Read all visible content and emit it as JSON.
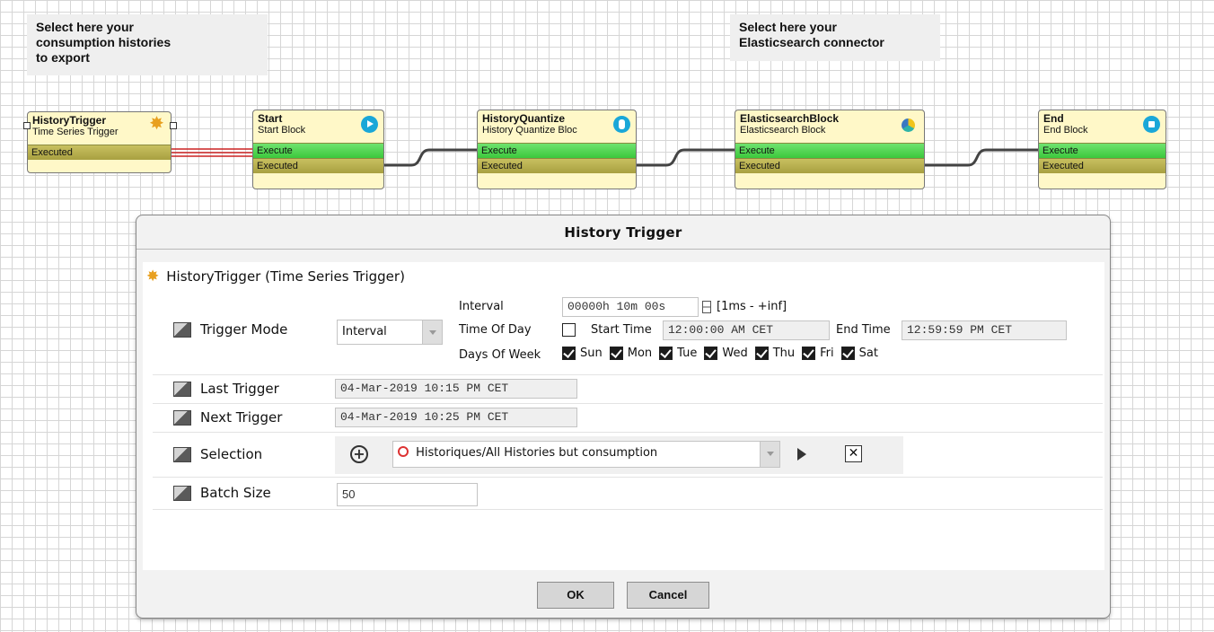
{
  "notes": {
    "left": [
      "Select here your",
      "consumption histories",
      "to export"
    ],
    "right": [
      "Select here your",
      "Elasticsearch connector"
    ]
  },
  "blocks": [
    {
      "title": "HistoryTrigger",
      "subtitle": "Time Series Trigger",
      "rows": [
        "Executed"
      ],
      "icon": "star-burst-icon"
    },
    {
      "title": "Start",
      "subtitle": "Start Block",
      "rows": [
        "Execute",
        "Executed"
      ],
      "icon": "play-icon"
    },
    {
      "title": "HistoryQuantize",
      "subtitle": "History Quantize Bloc",
      "rows": [
        "Execute",
        "Executed"
      ],
      "icon": "database-icon"
    },
    {
      "title": "ElasticsearchBlock",
      "subtitle": "Elasticsearch Block",
      "rows": [
        "Execute",
        "Executed"
      ],
      "icon": "elasticsearch-icon"
    },
    {
      "title": "End",
      "subtitle": "End Block",
      "rows": [
        "Execute",
        "Executed"
      ],
      "icon": "stop-icon"
    }
  ],
  "dialog": {
    "title": "History  Trigger",
    "component_header": "HistoryTrigger  (Time Series Trigger)",
    "trigger_mode": {
      "label": "Trigger Mode",
      "value": "Interval",
      "interval_label": "Interval",
      "interval_value": "00000h 10m 00s",
      "interval_range": "[1ms - +inf]",
      "time_of_day_label": "Time Of Day",
      "start_time_label": "Start Time",
      "start_time_value": "12:00:00 AM CET",
      "end_time_label": "End Time",
      "end_time_value": "12:59:59 PM CET",
      "days_label": "Days Of Week",
      "days": [
        "Sun",
        "Mon",
        "Tue",
        "Wed",
        "Thu",
        "Fri",
        "Sat"
      ]
    },
    "last_trigger": {
      "label": "Last Trigger",
      "value": "04-Mar-2019 10:15 PM CET"
    },
    "next_trigger": {
      "label": "Next Trigger",
      "value": "04-Mar-2019 10:25 PM CET"
    },
    "selection": {
      "label": "Selection",
      "value": "Historiques/All Histories but consumption"
    },
    "batch_size": {
      "label": "Batch Size",
      "value": "50"
    },
    "ok_label": "OK",
    "cancel_label": "Cancel"
  }
}
